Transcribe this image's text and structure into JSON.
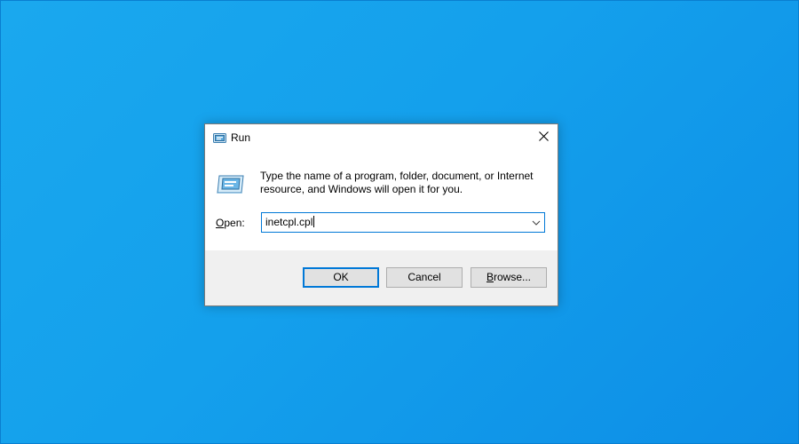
{
  "dialog": {
    "title": "Run",
    "description": "Type the name of a program, folder, document, or Internet resource, and Windows will open it for you.",
    "open_label_mnemonic": "O",
    "open_label_rest": "pen:",
    "input_value": "inetcpl.cpl",
    "buttons": {
      "ok": "OK",
      "cancel": "Cancel",
      "browse_mnemonic": "B",
      "browse_rest": "rowse..."
    }
  },
  "icons": {
    "title": "run-icon",
    "body": "run-icon",
    "close": "close-icon",
    "dropdown": "chevron-down-icon"
  },
  "colors": {
    "desktop": "#14a0ec",
    "accent": "#0078d7",
    "footer": "#f0f0f0",
    "button": "#e1e1e1"
  }
}
